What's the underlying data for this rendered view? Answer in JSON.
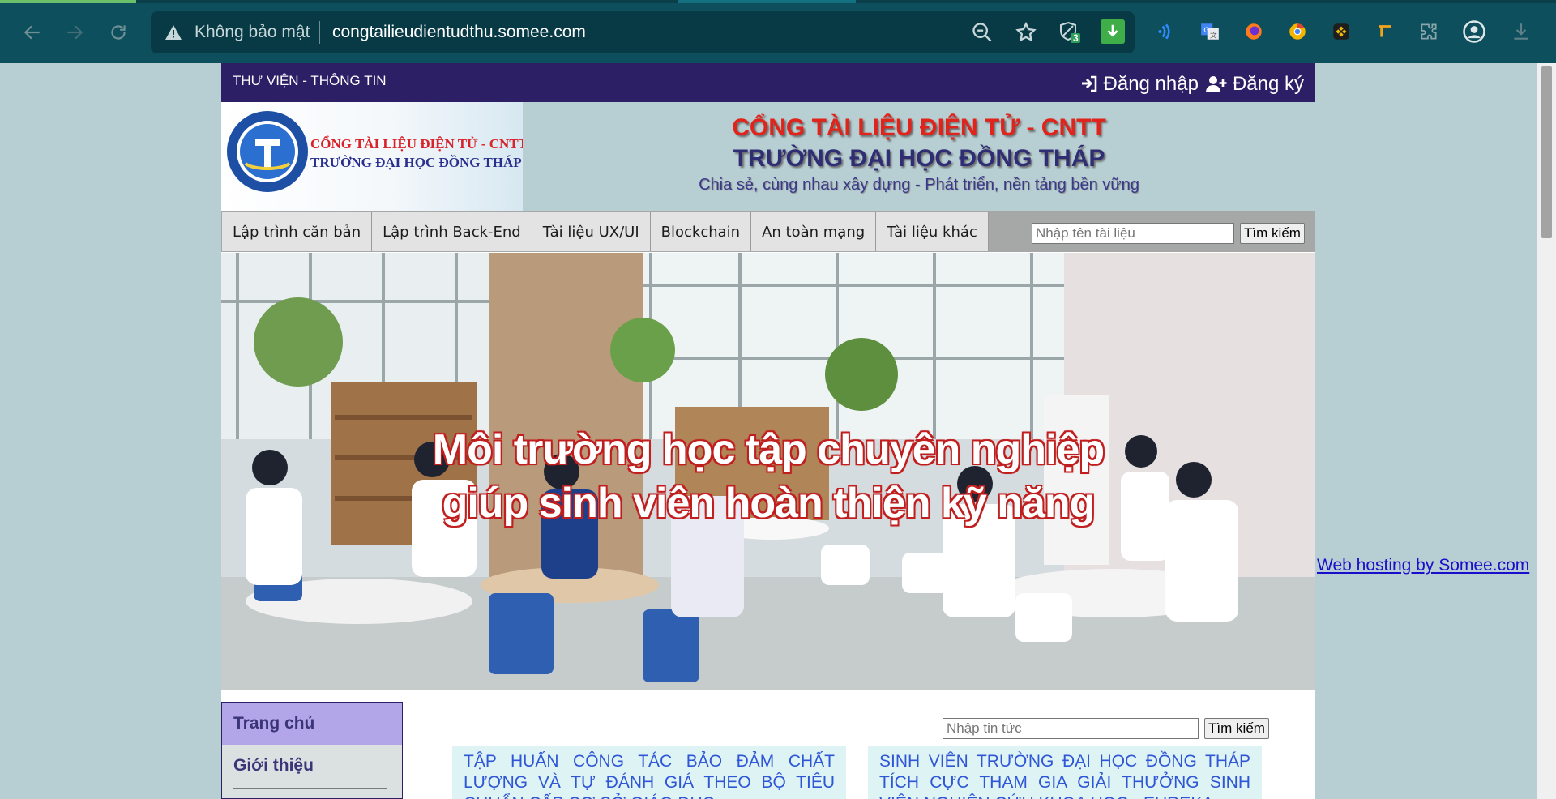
{
  "browser": {
    "security_label": "Không bảo mật",
    "url": "congtailieudientudthu.somee.com",
    "shield_badge": "3"
  },
  "topbar": {
    "title": "THƯ VIỆN - THÔNG TIN",
    "login": "Đăng nhập",
    "register": "Đăng ký"
  },
  "logo": {
    "line1": "CỔNG TÀI LIỆU ĐIỆN TỬ - CNTT",
    "line2": "TRƯỜNG ĐẠI HỌC ĐỒNG THÁP"
  },
  "header": {
    "line1": "CỔNG TÀI LIỆU ĐIỆN TỬ - CNTT",
    "line2": "TRƯỜNG ĐẠI HỌC ĐỒNG THÁP",
    "line3": "Chia sẻ, cùng nhau xây dựng - Phát triển, nền tảng bền vững"
  },
  "menu": {
    "items": [
      {
        "label": "Lập trình căn bản"
      },
      {
        "label": "Lập trình Back-End"
      },
      {
        "label": "Tài liệu UX/UI"
      },
      {
        "label": "Blockchain"
      },
      {
        "label": "An toàn mạng"
      },
      {
        "label": "Tài liệu khác"
      }
    ],
    "search_placeholder": "Nhập tên tài liệu",
    "search_button": "Tìm kiếm"
  },
  "banner": {
    "line1": "Môi trường học tập chuyên nghiệp",
    "line2": "giúp sinh viên hoàn thiện kỹ năng"
  },
  "sidebar": {
    "items": [
      {
        "label": "Trang chủ"
      },
      {
        "label": "Giới thiệu"
      }
    ]
  },
  "news": {
    "search_placeholder": "Nhập tin tức",
    "search_button": "Tìm kiếm",
    "cards": [
      {
        "title": "TẬP HUẤN CÔNG TÁC BẢO ĐẢM CHẤT LƯỢNG VÀ TỰ ĐÁNH GIÁ THEO BỘ TIÊU CHUẨN CẤP CƠ SỞ GIÁO DỤC"
      },
      {
        "title": "SINH VIÊN TRƯỜNG ĐẠI HỌC ĐỒNG THÁP TÍCH CỰC THAM GIA GIẢI THƯỞNG SINH VIÊN NGHIÊN CỨU KHOA HỌC - EUREKA"
      }
    ]
  },
  "footer_link": "Web hosting by Somee.com",
  "colors": {
    "chrome": "#0d4f5c",
    "topbar": "#2c1f66",
    "header_red": "#e0241b",
    "header_navy": "#2f2e74",
    "news_title": "#2f56d6",
    "sidebar_active": "#b2a6e8"
  }
}
